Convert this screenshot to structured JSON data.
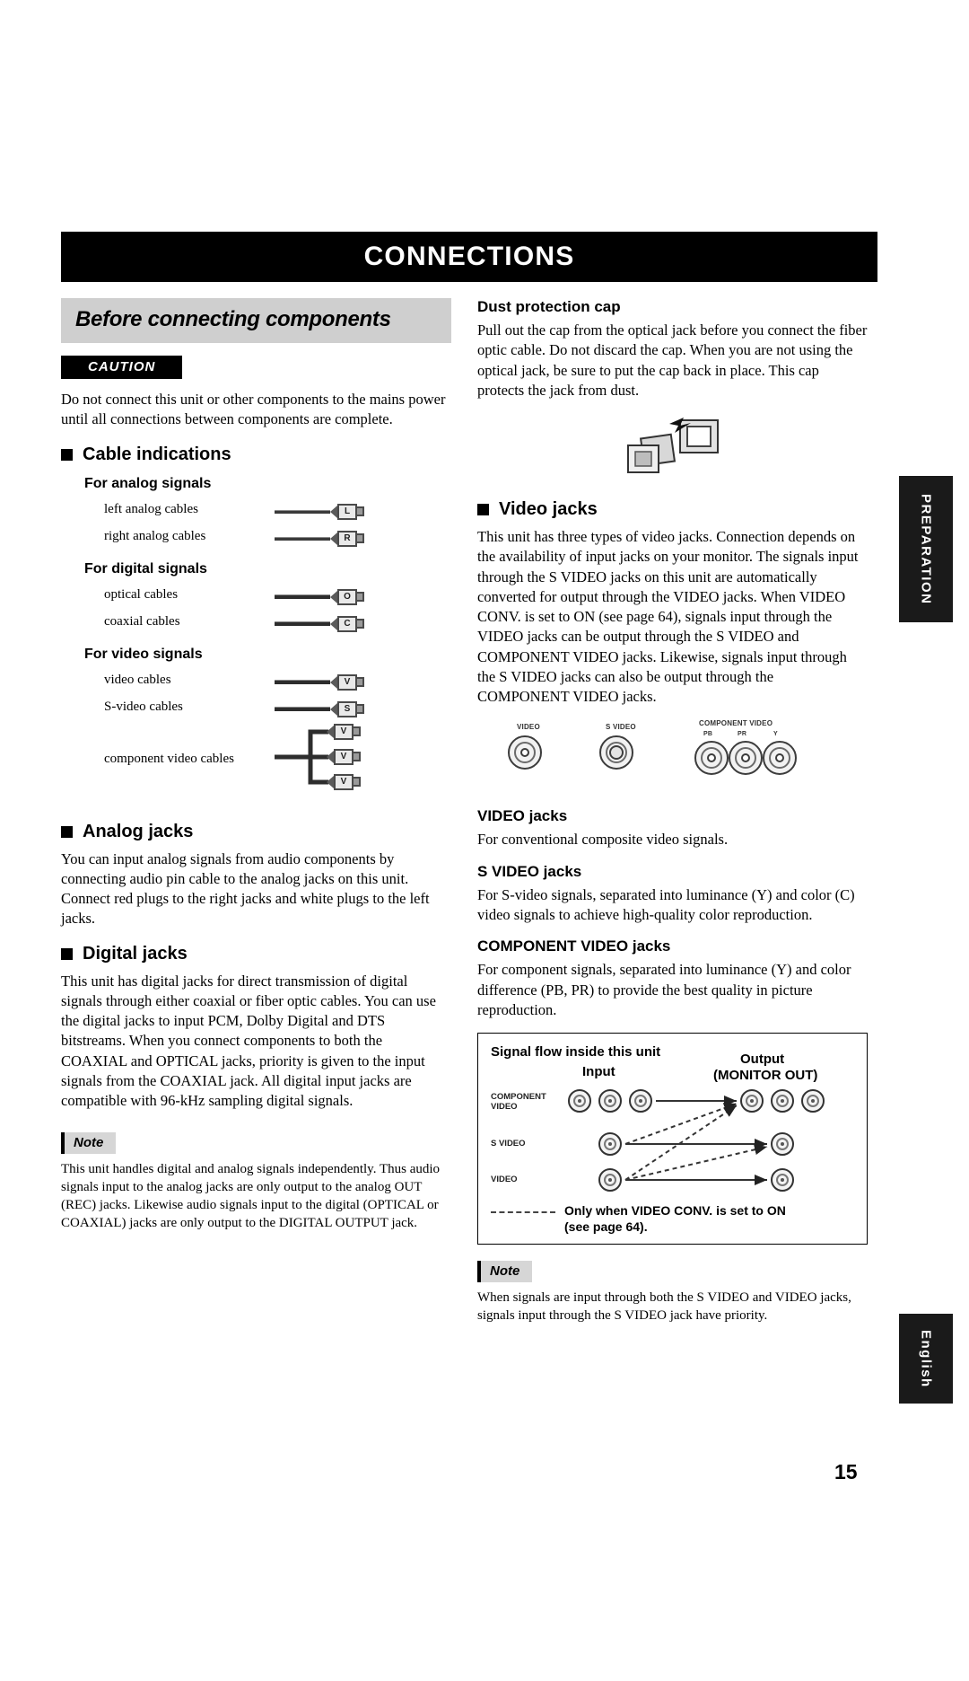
{
  "banner": {
    "title": "CONNECTIONS"
  },
  "page_number": "15",
  "side_tabs": {
    "preparation": "PREPARATION",
    "english": "English"
  },
  "left_column": {
    "section_title": "Before connecting components",
    "caution_badge": "CAUTION",
    "caution_text": "Do not connect this unit or other components to the mains power until all connections between components are complete.",
    "cable_indications": {
      "heading": "Cable indications",
      "groups": [
        {
          "title": "For analog signals",
          "rows": [
            {
              "label": "left analog cables",
              "plug": "L",
              "type": "single"
            },
            {
              "label": "right analog cables",
              "plug": "R",
              "type": "single"
            }
          ]
        },
        {
          "title": "For digital signals",
          "rows": [
            {
              "label": "optical cables",
              "plug": "O",
              "type": "single"
            },
            {
              "label": "coaxial cables",
              "plug": "C",
              "type": "single"
            }
          ]
        },
        {
          "title": "For video signals",
          "rows": [
            {
              "label": "video cables",
              "plug": "V",
              "type": "single"
            },
            {
              "label": "S-video cables",
              "plug": "S",
              "type": "single"
            },
            {
              "label": "component video cables",
              "plug": "V",
              "type": "triple",
              "plugs": [
                "V",
                "V",
                "V"
              ]
            }
          ]
        }
      ]
    },
    "analog_jacks": {
      "heading": "Analog jacks",
      "text": "You can input analog signals from audio components by connecting audio pin cable to the analog jacks on this unit. Connect red plugs to the right jacks and white plugs to the left jacks."
    },
    "digital_jacks": {
      "heading": "Digital jacks",
      "text": "This unit has digital jacks for direct transmission of digital signals through either coaxial or fiber optic cables. You can use the digital jacks to input PCM, Dolby Digital and DTS bitstreams. When you connect components to both the COAXIAL and OPTICAL jacks, priority is given to the input signals from the COAXIAL jack. All digital input jacks are compatible with 96-kHz sampling digital signals.",
      "note_badge": "Note",
      "note_text": "This unit handles digital and analog signals independently. Thus audio signals input to the analog jacks are only output to the analog OUT (REC) jacks. Likewise audio signals input to the digital (OPTICAL or COAXIAL) jacks are only output to the DIGITAL OUTPUT jack."
    }
  },
  "right_column": {
    "dust_protection_cap": {
      "heading": "Dust protection cap",
      "text": "Pull out the cap from the optical jack before you connect the fiber optic cable. Do not discard the cap. When you are not using the optical jack, be sure to put the cap back in place. This cap protects the jack from dust."
    },
    "video_jacks": {
      "heading": "Video jacks",
      "text": "This unit has three types of video jacks. Connection depends on the availability of input jacks on your monitor. The signals input through the S VIDEO jacks on this unit are automatically converted for output through the VIDEO jacks. When VIDEO CONV. is set to ON (see page 64), signals input through the VIDEO jacks can be output through the S VIDEO and COMPONENT VIDEO jacks. Likewise, signals input through the S VIDEO jacks can also be output through the COMPONENT VIDEO jacks."
    },
    "jack_diagram": {
      "video_label": "VIDEO",
      "svideo_label": "S VIDEO",
      "component_label": "COMPONENT VIDEO",
      "component_pins": [
        "PB",
        "PR",
        "Y"
      ]
    },
    "video_jacks_detail": {
      "heading": "VIDEO jacks",
      "text": "For conventional composite video signals."
    },
    "s_video_jacks_detail": {
      "heading": "S VIDEO jacks",
      "text": "For S-video signals, separated into luminance (Y) and color (C) video signals to achieve high-quality color reproduction."
    },
    "component_video_jacks_detail": {
      "heading": "COMPONENT VIDEO jacks",
      "text": "For component signals, separated into luminance (Y) and color difference (PB, PR) to provide the best quality in picture reproduction."
    },
    "signal_flow": {
      "title": "Signal flow inside this unit",
      "input_label": "Input",
      "output_label": "Output",
      "output_sub_label": "(MONITOR OUT)",
      "rows": [
        {
          "label_line1": "COMPONENT",
          "label_line2": "VIDEO",
          "input_jacks": 3,
          "output_jacks": 3
        },
        {
          "label_line1": "S VIDEO",
          "label_line2": "",
          "input_jacks": 1,
          "output_jacks": 1
        },
        {
          "label_line1": "VIDEO",
          "label_line2": "",
          "input_jacks": 1,
          "output_jacks": 1
        }
      ],
      "legend_line1": "Only when VIDEO CONV. is set to ON",
      "legend_line2": "(see page 64)."
    },
    "note_badge": "Note",
    "note_text": "When signals are input through both the S VIDEO and VIDEO jacks, signals input through the S VIDEO jack have priority."
  }
}
